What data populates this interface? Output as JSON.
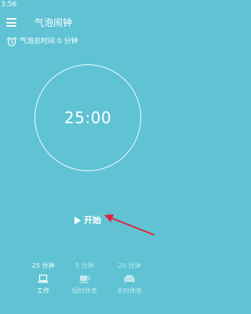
{
  "status_bar": {
    "time": "3:56"
  },
  "app_bar": {
    "title": "气泡闹钟",
    "menu_icon": "menu-icon"
  },
  "summary": {
    "total_text": "气泡总时间 0 分钟",
    "icon": "alarm-clock-icon"
  },
  "timer": {
    "display": "25:00"
  },
  "start": {
    "label": "开始",
    "icon": "play-icon"
  },
  "modes": [
    {
      "duration": "25 分钟",
      "label": "工作",
      "icon": "laptop-icon",
      "selected": true
    },
    {
      "duration": "5 分钟",
      "label": "短时休息",
      "icon": "coffee-cup-icon",
      "selected": false
    },
    {
      "duration": "20 分钟",
      "label": "长时休息",
      "icon": "sofa-icon",
      "selected": false
    }
  ],
  "colors": {
    "background": "#5fc3d4",
    "text": "#ffffff",
    "annotation_arrow": "#e0223a"
  }
}
